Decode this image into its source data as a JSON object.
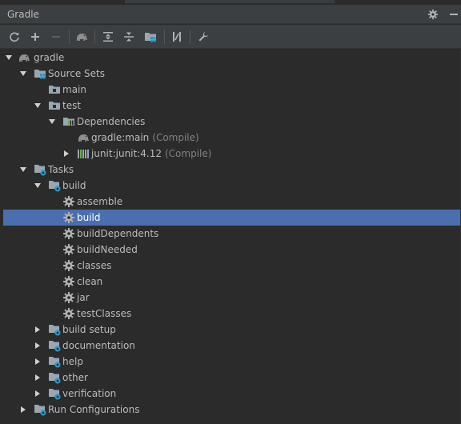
{
  "panel": {
    "title": "Gradle",
    "settings_icon": "gear-icon",
    "hide_icon": "minus-icon"
  },
  "toolbar": {
    "buttons": [
      {
        "name": "refresh-button",
        "icon": "refresh-icon"
      },
      {
        "name": "add-button",
        "icon": "plus-icon"
      },
      {
        "name": "remove-button",
        "icon": "minus-icon"
      },
      {
        "name": "execute-task-button",
        "icon": "gradle-elephant-icon"
      },
      {
        "name": "expand-all-button",
        "icon": "expand-all-icon"
      },
      {
        "name": "collapse-all-button",
        "icon": "collapse-all-icon"
      },
      {
        "name": "group-modules-button",
        "icon": "folder-modules-icon"
      },
      {
        "name": "toggle-offline-button",
        "icon": "offline-icon"
      },
      {
        "name": "build-settings-button",
        "icon": "wrench-icon"
      }
    ]
  },
  "tree": {
    "root": "gradle",
    "source_sets": "Source Sets",
    "main": "main",
    "test": "test",
    "dependencies": "Dependencies",
    "dep_gradle_main": "gradle:main",
    "dep_gradle_main_scope": "(Compile)",
    "dep_junit": "junit:junit:4.12",
    "dep_junit_scope": "(Compile)",
    "tasks": "Tasks",
    "build_group": "build",
    "build_tasks": [
      "assemble",
      "build",
      "buildDependents",
      "buildNeeded",
      "classes",
      "clean",
      "jar",
      "testClasses"
    ],
    "other_groups": [
      "build setup",
      "documentation",
      "help",
      "other",
      "verification"
    ],
    "run_configurations": "Run Configurations",
    "selected": "build"
  },
  "colors": {
    "background": "#2b2b2b",
    "chrome": "#3c3f41",
    "selection": "#4b6eaf",
    "text": "#bbbbbb",
    "muted": "#808080",
    "accent_blue": "#3592c4"
  }
}
